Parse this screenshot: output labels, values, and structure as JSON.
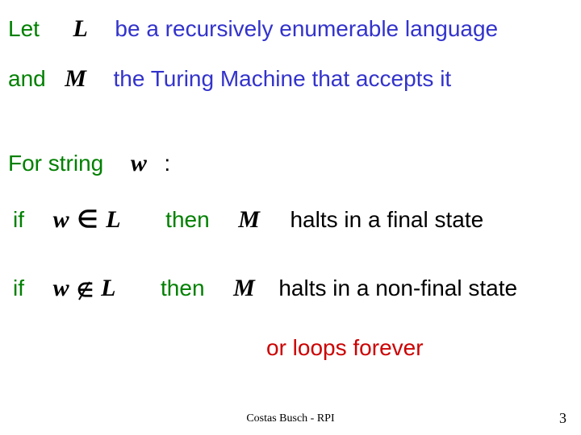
{
  "line1": {
    "let": "Let",
    "L": "L",
    "rest": "be a recursively enumerable language"
  },
  "line2": {
    "and": "and",
    "M": "M",
    "rest": "the Turing Machine that accepts it"
  },
  "forstring": {
    "label": "For string",
    "w": "w",
    "colon": ":"
  },
  "case1": {
    "if": "if",
    "cond_w": "w",
    "cond_in": "∈",
    "cond_L": "L",
    "then": "then",
    "M": "M",
    "result": "halts in a final state"
  },
  "case2": {
    "if": "if",
    "cond_w": "w",
    "cond_L": "L",
    "then": "then",
    "M": "M",
    "result": "halts in a non-final state",
    "or": "or loops forever"
  },
  "footer": "Costas Busch - RPI",
  "page": "3"
}
